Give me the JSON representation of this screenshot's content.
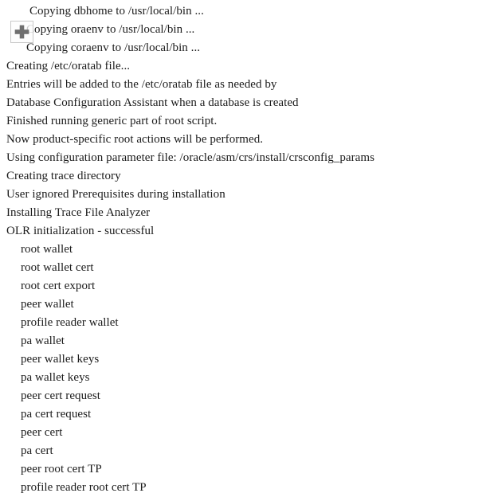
{
  "window": {
    "background_color": "#ffffff",
    "text_color": "#1b1b1b"
  },
  "overlay": {
    "drag_handle": {
      "icon": "move-cross-icon",
      "border_color": "#c9c9c9",
      "glyph_color": "#6f6f6f"
    }
  },
  "console": {
    "lines": [
      {
        "text": "Copying dbhome to /usr/local/bin ...",
        "indent": 2
      },
      {
        "text": "Copying oraenv to /usr/local/bin ...",
        "indent": 2
      },
      {
        "text": "Copying coraenv to /usr/local/bin ...",
        "indent": 2
      },
      {
        "text": "Creating /etc/oratab file...",
        "indent": 0
      },
      {
        "text": "Entries will be added to the /etc/oratab file as needed by",
        "indent": 0
      },
      {
        "text": "Database Configuration Assistant when a database is created",
        "indent": 0
      },
      {
        "text": "Finished running generic part of root script.",
        "indent": 0
      },
      {
        "text": "Now product-specific root actions will be performed.",
        "indent": 0
      },
      {
        "text": "Using configuration parameter file: /oracle/asm/crs/install/crsconfig_params",
        "indent": 0
      },
      {
        "text": "Creating trace directory",
        "indent": 0
      },
      {
        "text": "User ignored Prerequisites during installation",
        "indent": 0
      },
      {
        "text": "Installing Trace File Analyzer",
        "indent": 0
      },
      {
        "text": "OLR initialization - successful",
        "indent": 0
      },
      {
        "text": "root wallet",
        "indent": 1
      },
      {
        "text": "root wallet cert",
        "indent": 1
      },
      {
        "text": "root cert export",
        "indent": 1
      },
      {
        "text": "peer wallet",
        "indent": 1
      },
      {
        "text": "profile reader wallet",
        "indent": 1
      },
      {
        "text": "pa wallet",
        "indent": 1
      },
      {
        "text": "peer wallet keys",
        "indent": 1
      },
      {
        "text": "pa wallet keys",
        "indent": 1
      },
      {
        "text": "peer cert request",
        "indent": 1
      },
      {
        "text": "pa cert request",
        "indent": 1
      },
      {
        "text": "peer cert",
        "indent": 1
      },
      {
        "text": "pa cert",
        "indent": 1
      },
      {
        "text": "peer root cert TP",
        "indent": 1
      },
      {
        "text": "profile reader root cert TP",
        "indent": 1
      }
    ]
  }
}
